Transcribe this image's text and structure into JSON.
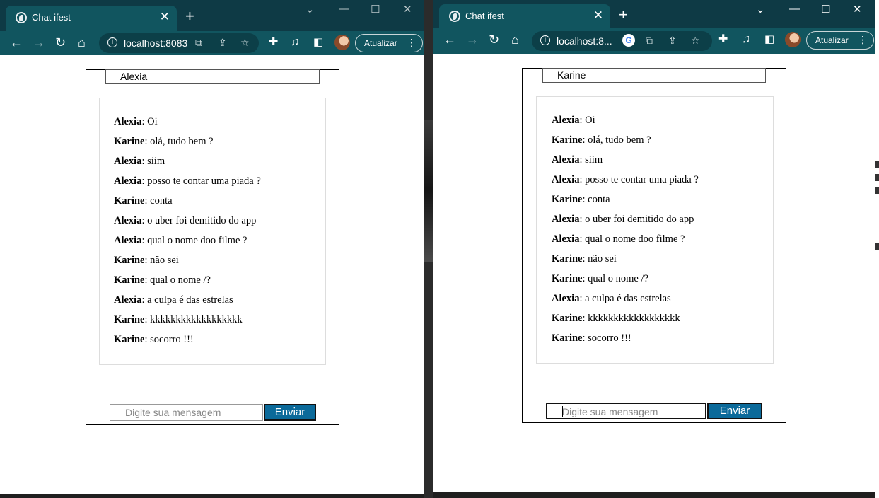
{
  "windows": [
    {
      "tab_title": "Chat ifest",
      "url": "localhost:8083",
      "update_label": "Atualizar",
      "username": "Alexia",
      "input_placeholder": "Digite sua mensagem",
      "send_label": "Enviar"
    },
    {
      "tab_title": "Chat ifest",
      "url": "localhost:8...",
      "update_label": "Atualizar",
      "username": "Karine",
      "input_placeholder": "Digite sua mensagem",
      "send_label": "Enviar"
    }
  ],
  "messages": [
    {
      "sender": "Alexia",
      "text": ": Oi"
    },
    {
      "sender": "Karine",
      "text": ": olá, tudo bem ?"
    },
    {
      "sender": "Alexia",
      "text": ": siim"
    },
    {
      "sender": "Alexia",
      "text": ": posso te contar uma piada ?"
    },
    {
      "sender": "Karine",
      "text": ": conta"
    },
    {
      "sender": "Alexia",
      "text": ": o uber foi demitido do app"
    },
    {
      "sender": "Alexia",
      "text": ": qual o nome doo filme ?"
    },
    {
      "sender": "Karine",
      "text": ": não sei"
    },
    {
      "sender": "Karine",
      "text": ": qual o nome /?"
    },
    {
      "sender": "Alexia",
      "text": ": a culpa é das estrelas"
    },
    {
      "sender": "Karine",
      "text": ": kkkkkkkkkkkkkkkkkk"
    },
    {
      "sender": "Karine",
      "text": ": socorro !!!"
    }
  ],
  "icons": {
    "globe": "globe-icon",
    "close": "close-icon",
    "plus": "plus-icon",
    "back": "back-arrow-icon",
    "forward": "forward-arrow-icon",
    "reload": "reload-icon",
    "home": "home-icon",
    "info": "info-icon",
    "translate": "translate-icon",
    "share": "share-icon",
    "star": "star-icon",
    "extensions": "puzzle-icon",
    "media": "media-icon",
    "sidepanel": "side-panel-icon",
    "menu": "kebab-menu-icon"
  },
  "colors": {
    "titlebar": "#0e3a45",
    "toolbar": "#11555f",
    "send_button": "#0b6a9a"
  }
}
